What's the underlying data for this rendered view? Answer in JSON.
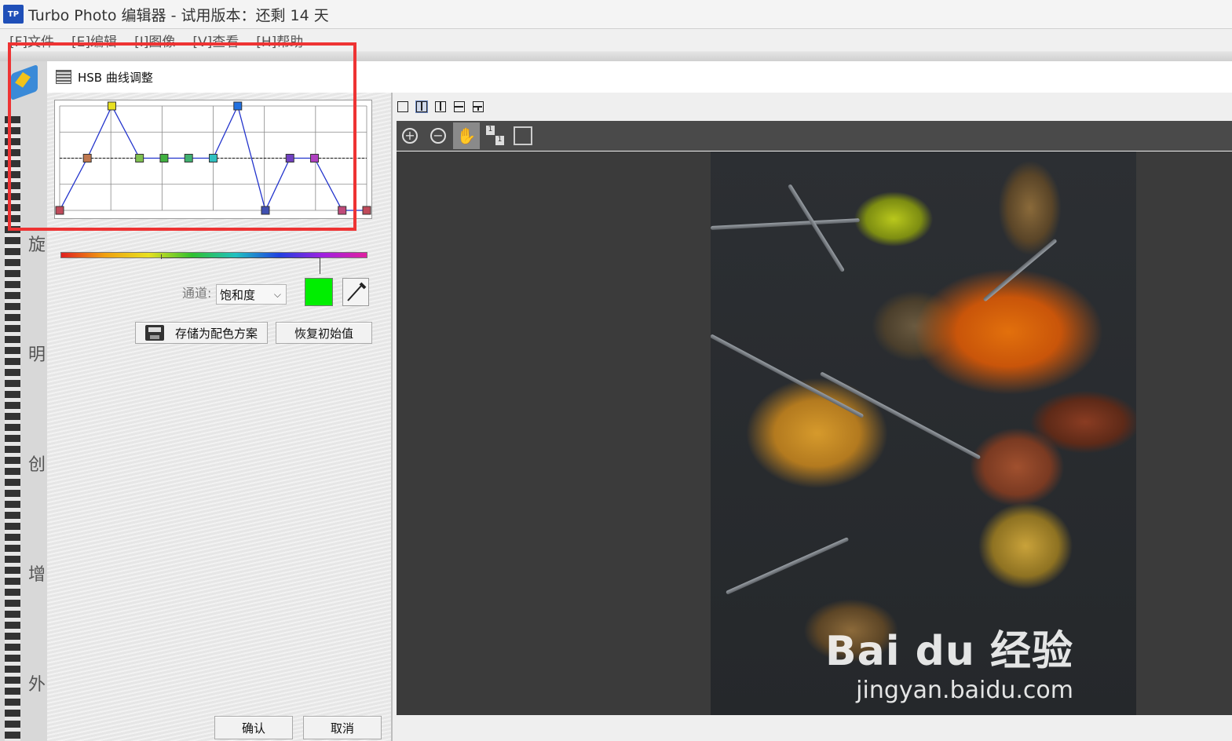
{
  "app": {
    "title": "Turbo Photo 编辑器 - 试用版本：还剩 14 天",
    "icon_label": "TP"
  },
  "menu": {
    "items": [
      "[F]文件",
      "[E]编辑",
      "[I]图像",
      "[V]查看",
      "[H]帮助"
    ]
  },
  "rail": {
    "glyphs": [
      "旋",
      "明",
      "创",
      "增",
      "外"
    ]
  },
  "dialog": {
    "title": "HSB 曲线调整",
    "channel_label": "通道:",
    "channel_value": "饱和度",
    "swatch_color": "#00ee00",
    "save_scheme_label": "存储为配色方案",
    "reset_label": "恢复初始值",
    "ok_label": "确认",
    "cancel_label": "取消"
  },
  "curve": {
    "nodes": [
      {
        "hue": 0.0,
        "level": 0.0,
        "color": "#c04a5a"
      },
      {
        "hue": 0.09,
        "level": 0.5,
        "color": "#c07850"
      },
      {
        "hue": 0.17,
        "level": 1.0,
        "color": "#e8e020"
      },
      {
        "hue": 0.26,
        "level": 0.5,
        "color": "#7ec050"
      },
      {
        "hue": 0.34,
        "level": 0.5,
        "color": "#40b040"
      },
      {
        "hue": 0.42,
        "level": 0.5,
        "color": "#40b070"
      },
      {
        "hue": 0.5,
        "level": 0.5,
        "color": "#30c0c0"
      },
      {
        "hue": 0.58,
        "level": 1.0,
        "color": "#2070e0"
      },
      {
        "hue": 0.67,
        "level": 0.0,
        "color": "#4050b0"
      },
      {
        "hue": 0.75,
        "level": 0.5,
        "color": "#7040c0"
      },
      {
        "hue": 0.83,
        "level": 0.5,
        "color": "#b040c0"
      },
      {
        "hue": 0.92,
        "level": 0.0,
        "color": "#c04a7a"
      },
      {
        "hue": 1.0,
        "level": 0.0,
        "color": "#c04a5a"
      }
    ],
    "line_color": "#2233cc"
  },
  "view": {
    "zoom_buttons": [
      "zoom-in",
      "zoom-out",
      "hand",
      "one-to-one",
      "fit"
    ]
  },
  "watermark": {
    "main": "Bai du 经验",
    "sub": "jingyan.baidu.com"
  }
}
